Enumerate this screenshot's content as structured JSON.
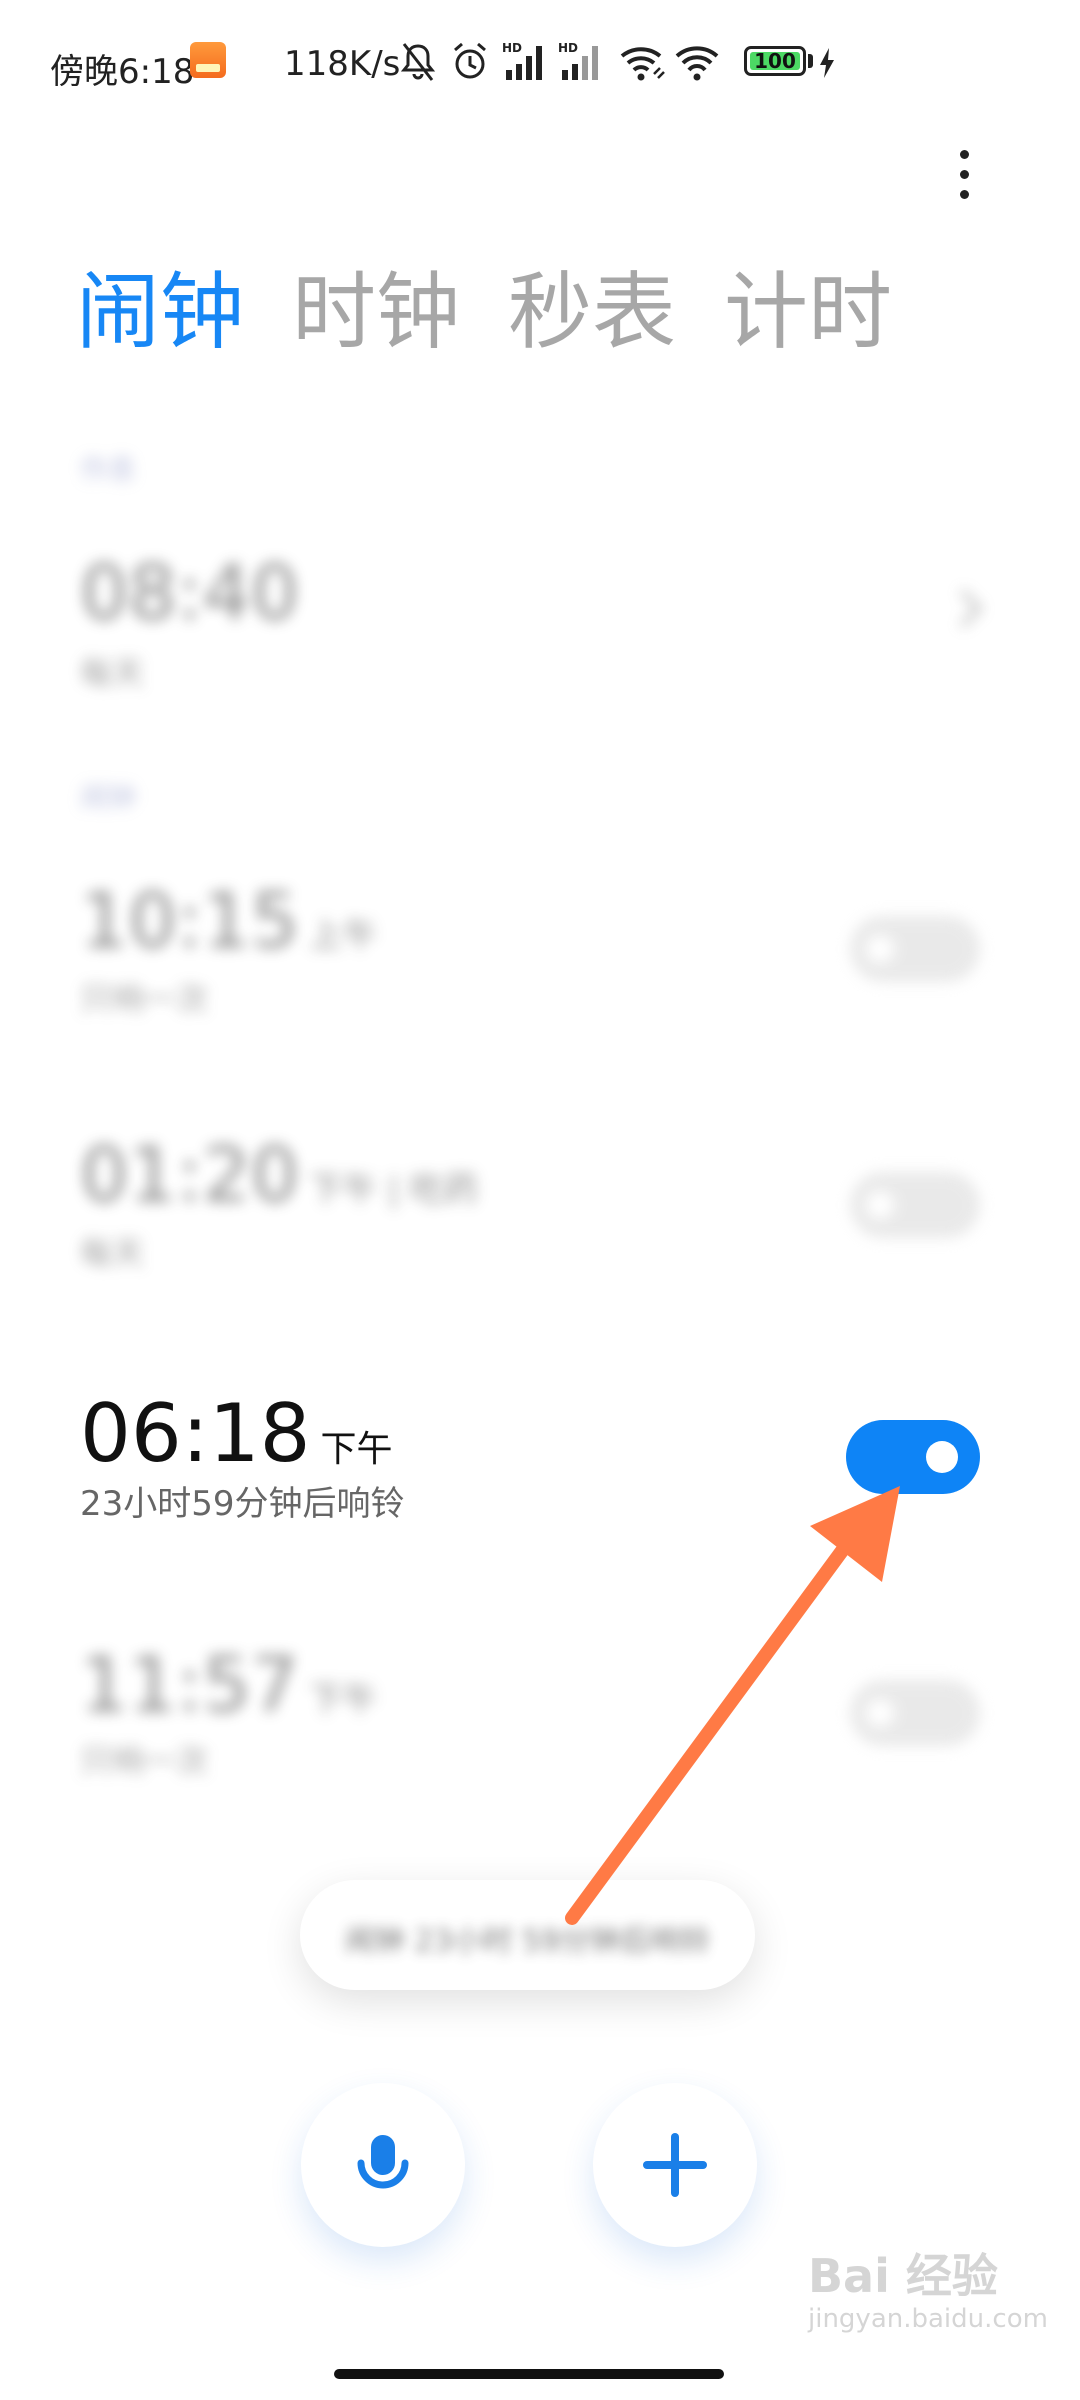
{
  "status_bar": {
    "time": "傍晚6:18",
    "speed": "118K/s",
    "battery": "100"
  },
  "tabs": [
    {
      "label": "闹钟",
      "active": true
    },
    {
      "label": "时钟",
      "active": false
    },
    {
      "label": "秒表",
      "active": false
    },
    {
      "label": "计时",
      "active": false
    }
  ],
  "alarms_blurred": {
    "section1_label": "作息",
    "alarm1_time": "08:40",
    "alarm1_sub": "每天",
    "section2_label": "闹钟",
    "alarm2_time": "10:15",
    "alarm2_ampm": "上午",
    "alarm2_sub": "只响一次",
    "alarm3_time": "01:20",
    "alarm3_ampm": "下午 | 吃药",
    "alarm3_sub": "每天",
    "alarm5_time": "11:57",
    "alarm5_ampm": "下午",
    "alarm5_sub": "只响一次"
  },
  "focused_alarm": {
    "time": "06:18",
    "ampm": "下午",
    "sub": "23小时59分钟后响铃",
    "enabled": true
  },
  "toast": {
    "text": "闹钟 23小时 59分钟后响铃"
  },
  "colors": {
    "accent": "#1787f5",
    "toggle_on": "#0e84f6",
    "arrow": "#ff7a45"
  },
  "icons": {
    "mic": "microphone-icon",
    "add": "plus-icon",
    "more": "more-vertical-icon"
  },
  "watermark": {
    "main": "Bai 经验",
    "sub": "jingyan.baidu.com"
  }
}
